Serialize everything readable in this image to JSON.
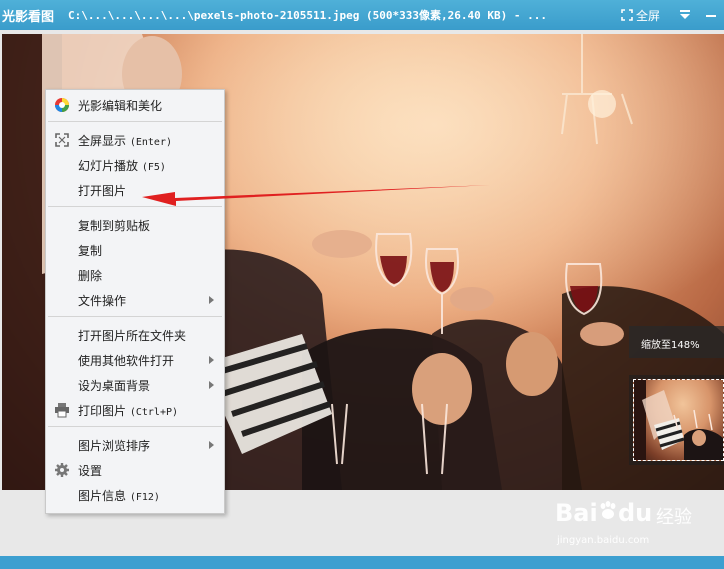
{
  "titlebar": {
    "app_name": "光影看图",
    "window_title": "C:\\...\\...\\...\\...\\pexels-photo-2105511.jpeg (500*333像素,26.40 KB) - ...",
    "fullscreen_label": "全屏",
    "accent": "#3a9ccb"
  },
  "menu": {
    "items": [
      {
        "label": "光影编辑和美化",
        "icon": "color-wheel-icon"
      },
      {
        "label": "全屏显示",
        "shortcut": "(Enter)",
        "icon": "fullscreen-icon"
      },
      {
        "label": "幻灯片播放",
        "shortcut": "(F5)"
      },
      {
        "label": "打开图片"
      },
      {
        "label": "复制到剪贴板"
      },
      {
        "label": "复制"
      },
      {
        "label": "删除"
      },
      {
        "label": "文件操作",
        "submenu": true
      },
      {
        "label": "打开图片所在文件夹"
      },
      {
        "label": "使用其他软件打开",
        "submenu": true
      },
      {
        "label": "设为桌面背景",
        "submenu": true
      },
      {
        "label": "打印图片",
        "shortcut": "(Ctrl+P)",
        "icon": "printer-icon"
      },
      {
        "label": "图片浏览排序",
        "submenu": true
      },
      {
        "label": "设置",
        "icon": "gear-icon"
      },
      {
        "label": "图片信息",
        "shortcut": "(F12)"
      }
    ]
  },
  "viewer": {
    "zoom_text": "缩放至148%"
  },
  "annotation": {
    "arrow_color": "#e02020"
  },
  "watermark": {
    "brand": "Bai",
    "brand2": "du",
    "suffix": "经验",
    "url": "jingyan.baidu.com"
  }
}
